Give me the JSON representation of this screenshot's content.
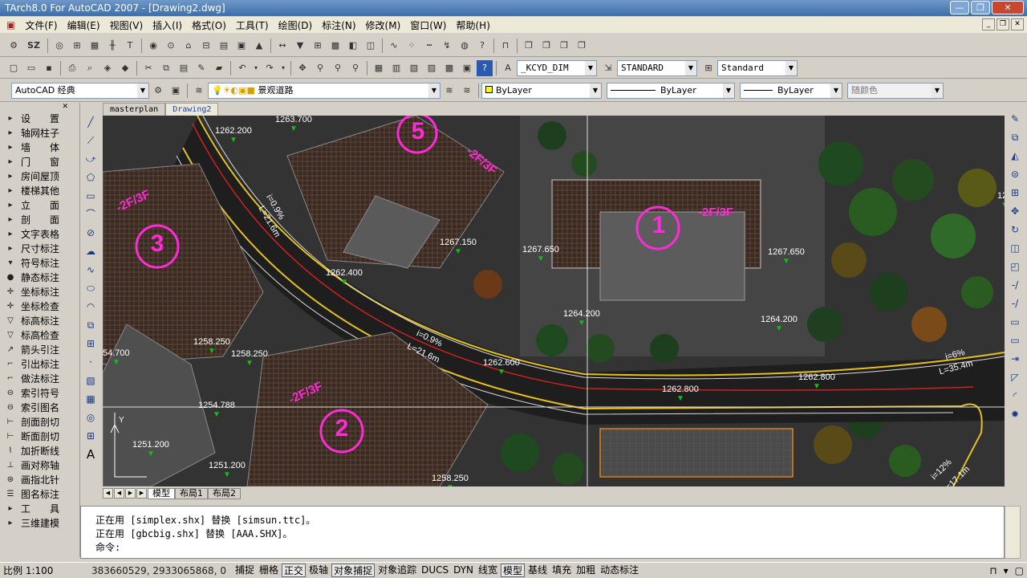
{
  "window": {
    "title": "TArch8.0 For AutoCAD 2007 - [Drawing2.dwg]"
  },
  "menu": [
    "文件(F)",
    "编辑(E)",
    "视图(V)",
    "插入(I)",
    "格式(O)",
    "工具(T)",
    "绘图(D)",
    "标注(N)",
    "修改(M)",
    "窗口(W)",
    "帮助(H)"
  ],
  "toolbar1": {
    "sz_label": "SZ"
  },
  "toolbar2": {
    "dimstyle": "_KCYD_DIM",
    "textstyle": "STANDARD",
    "tablestyle": "Standard"
  },
  "toolbar3": {
    "workspace": "AutoCAD 经典",
    "layer": "景观道路",
    "color": "ByLayer",
    "linetype": "ByLayer",
    "lineweight": "ByLayer",
    "plotstyle": "随颜色"
  },
  "doc_tabs": [
    "masterplan",
    "Drawing2"
  ],
  "sidebar": [
    "设　　置",
    "轴网柱子",
    "墙　　体",
    "门　　窗",
    "房间屋顶",
    "楼梯其他",
    "立　　面",
    "剖　　面",
    "文字表格",
    "尺寸标注",
    "符号标注",
    "静态标注",
    "坐标标注",
    "坐标检查",
    "标高标注",
    "标高检查",
    "箭头引注",
    "引出标注",
    "做法标注",
    "索引符号",
    "索引图名",
    "剖面剖切",
    "断面剖切",
    "加折断线",
    "画对称轴",
    "画指北针",
    "图名标注",
    "工　　具",
    "三维建模"
  ],
  "drawing": {
    "elevations": [
      "1262.200",
      "1263.700",
      "1267.150",
      "1267.650",
      "1267.650",
      "1262.400",
      "1264.200",
      "1264.200",
      "1258.250",
      "1258.250",
      "1262.600",
      "1262.800",
      "1262.800",
      "1254.788",
      "1251.200",
      "1251.200",
      "1258.250",
      "54.700",
      "126"
    ],
    "buildings": [
      {
        "num": "1",
        "floors": "-2F/3F"
      },
      {
        "num": "2",
        "floors": "-2F/3F"
      },
      {
        "num": "3",
        "floors": "-2F/3F"
      },
      {
        "num": "5",
        "floors": "-2F/3F"
      }
    ],
    "slopes": [
      "i=0.9%",
      "L=21.6m",
      "i=0.9%",
      "L=21.6m",
      "i=6%",
      "L=35.4m",
      "i=12%",
      "L=17.1m"
    ]
  },
  "layout_tabs": [
    "模型",
    "布局1",
    "布局2"
  ],
  "command_lines": [
    "正在用 [simplex.shx] 替换 [simsun.ttc]。",
    "正在用 [gbcbig.shx] 替换 [AAA.SHX]。"
  ],
  "command_prompt": "命令:",
  "status": {
    "scale": "比例 1:100",
    "coords": "383660529, 2933065868, 0",
    "buttons": [
      "捕捉",
      "栅格",
      "正交",
      "极轴",
      "对象捕捉",
      "对象追踪",
      "DUCS",
      "DYN",
      "线宽",
      "模型",
      "基线",
      "填充",
      "加粗",
      "动态标注"
    ],
    "active": [
      "正交",
      "对象捕捉",
      "模型"
    ]
  },
  "colors": {
    "magenta": "#ff2bd6",
    "marker": "#10c010",
    "road_edge": "#e6c020"
  }
}
